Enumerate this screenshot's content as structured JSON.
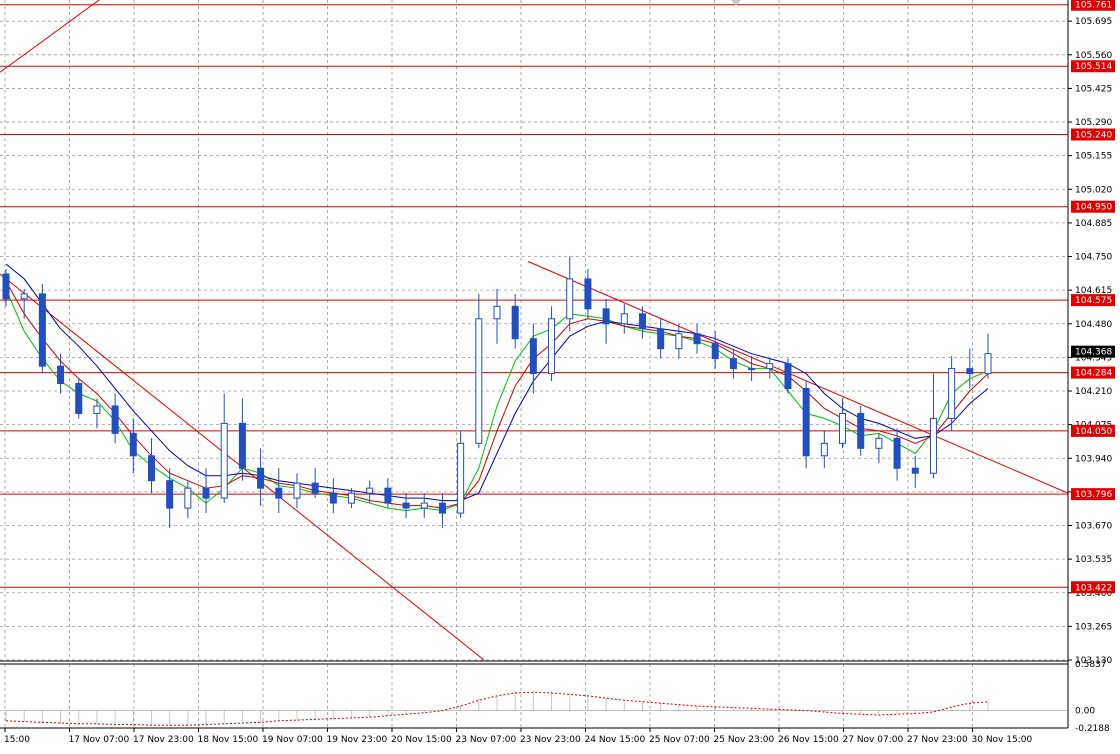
{
  "chart_data": {
    "type": "candlestick",
    "price_axis": {
      "ylim": [
        103.13,
        105.78
      ],
      "ticks": [
        "105.695",
        "105.560",
        "105.425",
        "105.290",
        "105.155",
        "105.020",
        "104.885",
        "104.750",
        "104.615",
        "104.480",
        "104.345",
        "104.210",
        "104.075",
        "103.940",
        "103.805",
        "103.670",
        "103.535",
        "103.400",
        "103.265",
        "103.130"
      ]
    },
    "time_axis": {
      "labels": [
        "15:00",
        "17 Nov 07:00",
        "17 Nov 23:00",
        "18 Nov 15:00",
        "19 Nov 07:00",
        "19 Nov 23:00",
        "20 Nov 15:00",
        "23 Nov 07:00",
        "23 Nov 23:00",
        "24 Nov 15:00",
        "25 Nov 07:00",
        "25 Nov 23:00",
        "26 Nov 15:00",
        "27 Nov 07:00",
        "27 Nov 23:00",
        "30 Nov 15:00"
      ]
    },
    "current_price": "104.368",
    "horizontal_levels": [
      "105.761",
      "105.514",
      "105.240",
      "104.950",
      "104.575",
      "104.284",
      "104.050",
      "103.796",
      "103.422"
    ],
    "trendlines": [
      {
        "from": [
          "15:00",
          105.49
        ],
        "to": [
          "17 Nov 07:00",
          105.8
        ]
      },
      {
        "from": [
          "15:00",
          104.68
        ],
        "to": [
          "23 Nov 23:00",
          103.13
        ]
      },
      {
        "from": [
          "24 Nov 15:00",
          104.73
        ],
        "to": [
          "30 Nov 15:00",
          103.8
        ]
      }
    ],
    "moving_averages": [
      {
        "color": "#00c000",
        "values": [
          104.62,
          104.45,
          104.34,
          104.25,
          104.2,
          104.17,
          104.09,
          103.97,
          103.91,
          103.86,
          103.82,
          103.76,
          103.82,
          103.9,
          103.88,
          103.83,
          103.82,
          103.8,
          103.79,
          103.78,
          103.76,
          103.74,
          103.73,
          103.74,
          103.73,
          103.76,
          103.9,
          104.15,
          104.33,
          104.43,
          104.46,
          104.52,
          104.51,
          104.5,
          104.47,
          104.45,
          104.44,
          104.43,
          104.41,
          104.38,
          104.33,
          104.3,
          104.3,
          104.21,
          104.12,
          104.1,
          104.07,
          104.03,
          104.04,
          104.0,
          103.96,
          104.05,
          104.2,
          104.26,
          104.29
        ]
      },
      {
        "color": "#d00000",
        "values": [
          104.65,
          104.52,
          104.42,
          104.33,
          104.26,
          104.2,
          104.12,
          104.03,
          103.95,
          103.88,
          103.85,
          103.82,
          103.83,
          103.87,
          103.86,
          103.84,
          103.83,
          103.81,
          103.8,
          103.79,
          103.77,
          103.76,
          103.75,
          103.75,
          103.74,
          103.76,
          103.85,
          104.05,
          104.23,
          104.34,
          104.4,
          104.48,
          104.5,
          104.49,
          104.47,
          104.46,
          104.45,
          104.43,
          104.42,
          104.4,
          104.36,
          104.32,
          104.3,
          104.27,
          104.21,
          104.14,
          104.1,
          104.06,
          104.05,
          104.03,
          104.0,
          104.03,
          104.12,
          104.21,
          104.28
        ]
      },
      {
        "color": "#0000c0",
        "values": [
          104.72,
          104.66,
          104.56,
          104.46,
          104.39,
          104.31,
          104.22,
          104.13,
          104.05,
          103.97,
          103.91,
          103.87,
          103.87,
          103.88,
          103.87,
          103.85,
          103.84,
          103.83,
          103.82,
          103.81,
          103.8,
          103.79,
          103.78,
          103.78,
          103.77,
          103.77,
          103.8,
          103.96,
          104.12,
          104.25,
          104.34,
          104.43,
          104.47,
          104.49,
          104.48,
          104.47,
          104.46,
          104.45,
          104.44,
          104.42,
          104.39,
          104.36,
          104.34,
          104.32,
          104.28,
          104.2,
          104.14,
          104.1,
          104.08,
          104.05,
          104.02,
          104.03,
          104.08,
          104.16,
          104.22
        ]
      }
    ],
    "candles": [
      [
        104.68,
        104.7,
        104.55,
        104.58
      ],
      [
        104.58,
        104.62,
        104.5,
        104.6
      ],
      [
        104.6,
        104.64,
        104.28,
        104.31
      ],
      [
        104.31,
        104.36,
        104.2,
        104.24
      ],
      [
        104.24,
        104.26,
        104.1,
        104.12
      ],
      [
        104.12,
        104.18,
        104.06,
        104.15
      ],
      [
        104.15,
        104.2,
        104.0,
        104.04
      ],
      [
        104.04,
        104.1,
        103.88,
        103.95
      ],
      [
        103.95,
        104.02,
        103.8,
        103.85
      ],
      [
        103.85,
        103.9,
        103.66,
        103.74
      ],
      [
        103.74,
        103.85,
        103.7,
        103.82
      ],
      [
        103.82,
        103.9,
        103.72,
        103.78
      ],
      [
        103.78,
        104.2,
        103.76,
        104.08
      ],
      [
        104.08,
        104.18,
        103.85,
        103.9
      ],
      [
        103.9,
        103.98,
        103.75,
        103.82
      ],
      [
        103.82,
        103.9,
        103.72,
        103.78
      ],
      [
        103.78,
        103.88,
        103.74,
        103.84
      ],
      [
        103.84,
        103.9,
        103.78,
        103.8
      ],
      [
        103.8,
        103.86,
        103.72,
        103.76
      ],
      [
        103.76,
        103.82,
        103.74,
        103.8
      ],
      [
        103.8,
        103.85,
        103.76,
        103.82
      ],
      [
        103.82,
        103.86,
        103.74,
        103.76
      ],
      [
        103.76,
        103.8,
        103.7,
        103.74
      ],
      [
        103.74,
        103.8,
        103.7,
        103.76
      ],
      [
        103.76,
        103.8,
        103.66,
        103.72
      ],
      [
        103.72,
        104.05,
        103.7,
        104.0
      ],
      [
        104.0,
        104.6,
        103.98,
        104.5
      ],
      [
        104.5,
        104.62,
        104.4,
        104.55
      ],
      [
        104.55,
        104.6,
        104.38,
        104.42
      ],
      [
        104.42,
        104.48,
        104.2,
        104.28
      ],
      [
        104.28,
        104.55,
        104.25,
        104.5
      ],
      [
        104.5,
        104.75,
        104.45,
        104.66
      ],
      [
        104.66,
        104.7,
        104.5,
        104.54
      ],
      [
        104.54,
        104.58,
        104.4,
        104.48
      ],
      [
        104.48,
        104.56,
        104.44,
        104.52
      ],
      [
        104.52,
        104.55,
        104.42,
        104.46
      ],
      [
        104.46,
        104.5,
        104.34,
        104.38
      ],
      [
        104.38,
        104.48,
        104.34,
        104.44
      ],
      [
        104.44,
        104.48,
        104.36,
        104.4
      ],
      [
        104.4,
        104.45,
        104.3,
        104.34
      ],
      [
        104.34,
        104.38,
        104.26,
        104.3
      ],
      [
        104.3,
        104.35,
        104.25,
        104.3
      ],
      [
        104.3,
        104.34,
        104.26,
        104.32
      ],
      [
        104.32,
        104.34,
        104.2,
        104.22
      ],
      [
        104.22,
        104.25,
        103.9,
        103.95
      ],
      [
        103.95,
        104.05,
        103.9,
        104.0
      ],
      [
        104.0,
        104.18,
        103.98,
        104.12
      ],
      [
        104.12,
        104.15,
        103.95,
        103.98
      ],
      [
        103.98,
        104.04,
        103.92,
        104.02
      ],
      [
        104.02,
        104.06,
        103.85,
        103.9
      ],
      [
        103.9,
        103.95,
        103.82,
        103.88
      ],
      [
        103.88,
        104.28,
        103.86,
        104.1
      ],
      [
        104.1,
        104.35,
        104.05,
        104.3
      ],
      [
        104.3,
        104.38,
        104.22,
        104.28
      ],
      [
        104.28,
        104.44,
        104.26,
        104.36
      ]
    ],
    "oscillator": {
      "ylim": [
        -0.2188,
        0.5837
      ],
      "ticks": [
        "0.5837",
        "0.00",
        "-0.2188"
      ],
      "values": [
        -0.14,
        -0.15,
        -0.16,
        -0.17,
        -0.18,
        -0.18,
        -0.19,
        -0.19,
        -0.2,
        -0.2,
        -0.2,
        -0.19,
        -0.18,
        -0.17,
        -0.16,
        -0.14,
        -0.13,
        -0.12,
        -0.11,
        -0.1,
        -0.09,
        -0.07,
        -0.05,
        -0.03,
        0.0,
        0.06,
        0.14,
        0.2,
        0.24,
        0.25,
        0.24,
        0.22,
        0.2,
        0.17,
        0.14,
        0.12,
        0.1,
        0.08,
        0.06,
        0.05,
        0.04,
        0.03,
        0.02,
        0.01,
        0.0,
        -0.02,
        -0.04,
        -0.05,
        -0.06,
        -0.05,
        -0.04,
        -0.02,
        0.05,
        0.1,
        0.12
      ],
      "signal_color": "#d00000"
    }
  },
  "colors": {
    "candle": "#1f4fc2",
    "level": "#e00000",
    "price_badge": "#000000",
    "grid": "#9a9a9a"
  }
}
